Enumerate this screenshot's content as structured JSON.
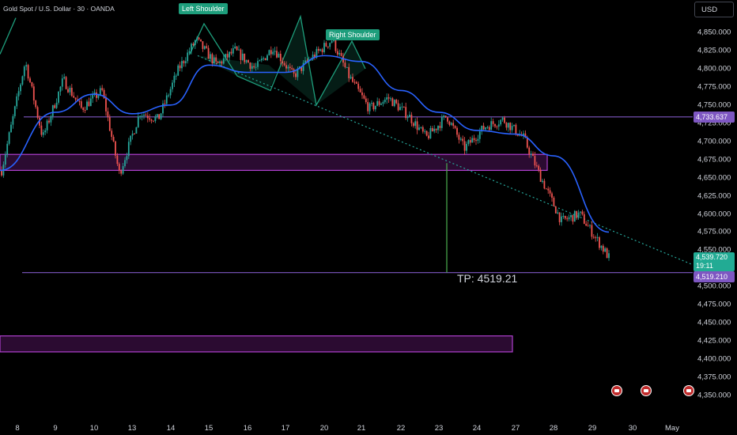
{
  "header": {
    "symbol": "Gold Spot / U.S. Dollar · 30 · OANDA",
    "currency": "USD"
  },
  "price_axis": {
    "ticks": [
      "4,850.000",
      "4,825.000",
      "4,800.000",
      "4,775.000",
      "4,750.000",
      "4,725.000",
      "4,700.000",
      "4,675.000",
      "4,650.000",
      "4,625.000",
      "4,600.000",
      "4,575.000",
      "4,550.000",
      "4,500.000",
      "4,475.000",
      "4,450.000",
      "4,425.000",
      "4,400.000",
      "4,375.000",
      "4,350.000"
    ],
    "tags": {
      "resistance": {
        "text": "4,733.637",
        "color": "#7e57c2"
      },
      "last_price": {
        "text": "4,539.720",
        "sub": "19:11",
        "color": "#22ab94"
      },
      "tp": {
        "text": "4,519.210",
        "color": "#7e57c2"
      }
    }
  },
  "time_axis": {
    "labels": [
      "8",
      "9",
      "10",
      "13",
      "14",
      "15",
      "16",
      "17",
      "20",
      "21",
      "22",
      "23",
      "24",
      "27",
      "28",
      "29",
      "30",
      "May"
    ]
  },
  "annotations": {
    "left_shoulder": "Left Shoulder",
    "right_shoulder": "Right Shoulder",
    "tp_text": "TP: 4519.21"
  },
  "colors": {
    "up": "#26a69a",
    "down": "#ef5350",
    "ma": "#2962ff",
    "zone": "#9c27b0",
    "hline": "#7e57c2",
    "pattern": "#1e9e7c"
  },
  "icons": [
    "us-flag-icon",
    "us-flag-icon",
    "us-flag-icon"
  ],
  "chart_data": {
    "type": "line",
    "symbol": "XAUUSD",
    "timeframe": "30",
    "x_labels": [
      "8",
      "9",
      "10",
      "13",
      "14",
      "15",
      "16",
      "17",
      "20",
      "21",
      "22",
      "23",
      "24",
      "27",
      "28",
      "29",
      "30",
      "May"
    ],
    "ylim": [
      4340,
      4870
    ],
    "series": [
      {
        "kind": "price",
        "x": [
          "8",
          "8",
          "9",
          "9",
          "10",
          "10",
          "13",
          "13",
          "14",
          "14",
          "15",
          "15",
          "16",
          "16",
          "17",
          "17",
          "20",
          "20",
          "21",
          "21",
          "22",
          "22",
          "23",
          "23",
          "24",
          "24",
          "27",
          "27",
          "28",
          "28",
          "29",
          "29"
        ],
        "values": [
          4660,
          4810,
          4705,
          4785,
          4745,
          4770,
          4655,
          4740,
          4730,
          4800,
          4840,
          4805,
          4825,
          4800,
          4830,
          4790,
          4815,
          4840,
          4790,
          4745,
          4760,
          4735,
          4705,
          4735,
          4690,
          4720,
          4730,
          4705,
          4650,
          4590,
          4600,
          4540
        ]
      },
      {
        "kind": "moving_average",
        "x": [
          "8",
          "9",
          "10",
          "13",
          "14",
          "15",
          "16",
          "17",
          "20",
          "21",
          "22",
          "23",
          "24",
          "27",
          "28",
          "29"
        ],
        "values": [
          4660,
          4740,
          4765,
          4738,
          4750,
          4805,
          4795,
          4795,
          4818,
          4810,
          4770,
          4740,
          4715,
          4710,
          4680,
          4575
        ]
      }
    ],
    "horizontal_lines": [
      4733.637,
      4519.21
    ],
    "zones": [
      [
        4660,
        4682
      ],
      [
        4410,
        4432
      ]
    ],
    "trendline": {
      "from": [
        "15",
        4818
      ],
      "to": [
        "30",
        4542
      ]
    },
    "pattern": [
      "Left Shoulder",
      "Right Shoulder"
    ],
    "last_price": 4539.72,
    "grid": false
  }
}
